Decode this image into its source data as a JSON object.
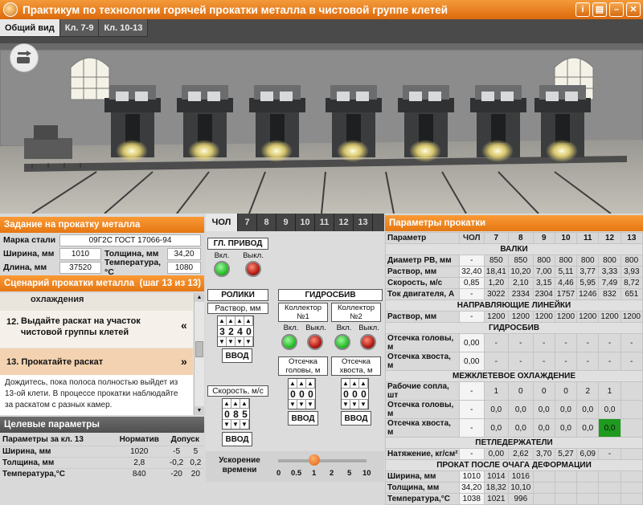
{
  "window": {
    "title": "Практикум по технологии горячей прокатки металла в чистовой группе клетей"
  },
  "view_tabs": [
    "Общий вид",
    "Кл. 7-9",
    "Кл. 10-13"
  ],
  "task_panel": {
    "title": "Задание на прокатку металла",
    "steel_label": "Марка стали",
    "steel_value": "09Г2С ГОСТ 17066-94",
    "width_label": "Ширина, мм",
    "width_value": "1010",
    "thickness_label": "Толщина, мм",
    "thickness_value": "34,20",
    "length_label": "Длина, мм",
    "length_value": "37520",
    "temp_label": "Температура,°C",
    "temp_value": "1080"
  },
  "scenario": {
    "title": "Сценарий прокатки металла",
    "step_counter": "(шаг 13 из 13)",
    "partial_step": "охлаждения",
    "step12_num": "12.",
    "step12_text": "Выдайте раскат на участок чистовой группы клетей",
    "step12_arrow": "«",
    "step13_text": "13. Прокатайте раскат",
    "step13_arrow": "»",
    "description": "Дождитесь, пока полоса полностью выйдет из 13-ой клети. В процессе прокатки наблюдайте за раскатом с разных камер."
  },
  "target_params": {
    "title": "Целевые параметры",
    "headers": [
      "Параметры за кл. 13",
      "Норматив",
      "Допуск",
      ""
    ],
    "rows": [
      [
        "Ширина, мм",
        "1020",
        "-5",
        "5"
      ],
      [
        "Толщина, мм",
        "2,8",
        "-0,2",
        "0,2"
      ],
      [
        "Температура,°C",
        "840",
        "-20",
        "20"
      ]
    ]
  },
  "control_tabs": [
    "ЧОЛ",
    "7",
    "8",
    "9",
    "10",
    "11",
    "12",
    "13"
  ],
  "controls": {
    "main_drive": "ГЛ. ПРИВОД",
    "on": "Вкл.",
    "off": "Выкл.",
    "rollers": "РОЛИКИ",
    "gap_label": "Раствор, мм",
    "gap_digits": [
      "3",
      "2",
      "4",
      "0"
    ],
    "speed_label": "Скорость, м/с",
    "speed_digits": [
      "0",
      "8",
      "5"
    ],
    "hydro": "ГИДРОСБИВ",
    "collector1": "Коллектор №1",
    "collector2": "Коллектор №2",
    "cut_head": "Отсечка головы, м",
    "cut_tail": "Отсечка хвоста, м",
    "cut_head_digits": [
      "0",
      "0",
      "0"
    ],
    "cut_tail_digits": [
      "0",
      "0",
      "0"
    ],
    "enter": "ВВОД",
    "time_accel": "Ускорение времени",
    "time_ticks": [
      "0",
      "0.5",
      "1",
      "2",
      "5",
      "10"
    ],
    "time_value": 1
  },
  "rolling_params": {
    "title": "Параметры прокатки",
    "header": [
      "Параметр",
      "ЧОЛ",
      "7",
      "8",
      "9",
      "10",
      "11",
      "12",
      "13"
    ],
    "rows": [
      {
        "section": "ВАЛКИ"
      },
      {
        "cells": [
          "Диаметр РВ, мм",
          "-",
          "850",
          "850",
          "800",
          "800",
          "800",
          "800",
          "800"
        ]
      },
      {
        "cells": [
          "Раствор, мм",
          "32,40",
          "18,41",
          "10,20",
          "7,00",
          "5,11",
          "3,77",
          "3,33",
          "3,93"
        ]
      },
      {
        "cells": [
          "Скорость, м/с",
          "0,85",
          "1,20",
          "2,10",
          "3,15",
          "4,46",
          "5,95",
          "7,49",
          "8,72"
        ]
      },
      {
        "cells": [
          "Ток двигателя, А",
          "-",
          "3022",
          "2334",
          "2304",
          "1757",
          "1246",
          "832",
          "651"
        ]
      },
      {
        "section": "НАПРАВЛЯЮЩИЕ ЛИНЕЙКИ"
      },
      {
        "cells": [
          "Раствор, мм",
          "-",
          "1200",
          "1200",
          "1200",
          "1200",
          "1200",
          "1200",
          "1200"
        ]
      },
      {
        "section": "ГИДРОСБИВ"
      },
      {
        "cells": [
          "Отсечка головы, м",
          "0,00",
          "-",
          "-",
          "-",
          "-",
          "-",
          "-",
          "-"
        ]
      },
      {
        "cells": [
          "Отсечка хвоста, м",
          "0,00",
          "-",
          "-",
          "-",
          "-",
          "-",
          "-",
          "-"
        ]
      },
      {
        "section": "МЕЖКЛЕТЕВОЕ ОХЛАЖДЕНИЕ"
      },
      {
        "cells": [
          "Рабочие сопла, шт",
          "-",
          "1",
          "0",
          "0",
          "0",
          "2",
          "1",
          ""
        ]
      },
      {
        "cells": [
          "Отсечка головы, м",
          "-",
          "0,0",
          "0,0",
          "0,0",
          "0,0",
          "0,0",
          "0,0",
          ""
        ]
      },
      {
        "cells": [
          "Отсечка хвоста, м",
          "-",
          "0,0",
          "0,0",
          "0,0",
          "0,0",
          "0,0",
          "0,0",
          ""
        ]
      },
      {
        "section": "ПЕТЛЕДЕРЖАТЕЛИ"
      },
      {
        "cells": [
          "Натяжение, кг/см²",
          "-",
          "0,00",
          "2,62",
          "3,70",
          "5,27",
          "6,09",
          "-",
          ""
        ]
      },
      {
        "section": "ПРОКАТ ПОСЛЕ ОЧАГА ДЕФОРМАЦИИ"
      },
      {
        "cells": [
          "Ширина, мм",
          "1010",
          "1014",
          "1016",
          "",
          "",
          "",
          "",
          ""
        ]
      },
      {
        "cells": [
          "Толщина, мм",
          "34,20",
          "18,32",
          "10,10",
          "",
          "",
          "",
          "",
          ""
        ]
      },
      {
        "cells": [
          "Температура,°C",
          "1038",
          "1021",
          "996",
          "",
          "",
          "",
          "",
          ""
        ]
      }
    ]
  },
  "colors": {
    "accent": "#e57712",
    "panel_dark": "#5b5b5b",
    "lamp_on": "#2bc02b",
    "lamp_off": "#b41c12"
  }
}
